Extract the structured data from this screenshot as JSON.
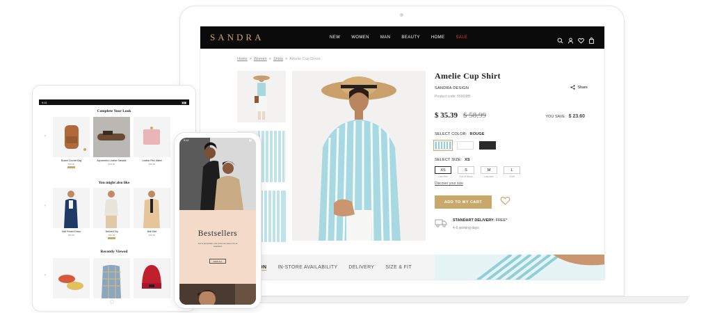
{
  "laptop": {
    "brand": "SANDRA",
    "nav": [
      "NEW",
      "WOMEN",
      "MAN",
      "BEAUTY",
      "HOME",
      "SALE"
    ],
    "nav_icons": [
      "search-icon",
      "user-icon",
      "heart-icon",
      "bag-icon"
    ],
    "breadcrumb": [
      "Home",
      "Women",
      "Shirts",
      "Amelie Cup Dress"
    ],
    "product": {
      "title": "Amelie Cup Shirt",
      "brand": "SANDRA DESIGN",
      "code": "Product code: 5590385",
      "share": "Share",
      "price": "$ 35.39",
      "old_price": "$ 58.99",
      "you_save_label": "YOU SAVE:",
      "you_save_value": "$ 23.60",
      "color_label": "SELECT COLOR:",
      "color_value": "ROUGE",
      "size_label": "SELECT SIZE:",
      "size_value": "XS",
      "size_guide": "Discover your size",
      "sizes": [
        {
          "label": "XS",
          "note": "Last item"
        },
        {
          "label": "S",
          "note": "Out of Stock"
        },
        {
          "label": "M",
          "note": "Last item"
        },
        {
          "label": "L",
          "note": "3 left"
        }
      ],
      "add_to_cart": "ADD TO MY CART",
      "delivery_title": "STANDART DELIVERY:",
      "delivery_free": "FREE*",
      "delivery_time": "4-6 working days"
    },
    "tabs": [
      "ION",
      "IN-STORE AVAILABILITY",
      "DELIVERY",
      "SIZE & FIT"
    ]
  },
  "tablet": {
    "time": "9:41",
    "section1": "Complete Your Look",
    "section2": "You might also like",
    "section3": "Recently Viewed",
    "row1": [
      {
        "name": "Bucket Crochet Bag",
        "price": "$59.99"
      },
      {
        "name": "Asymmetric Leather Sandals",
        "price": "$79.99"
      },
      {
        "name": "Leather Pink Wallet",
        "price": "$49.99"
      }
    ],
    "row2": [
      {
        "name": "Midi Printed Dress",
        "price": "$39.99"
      },
      {
        "name": "Textured Top",
        "price": "$29.99"
      },
      {
        "name": "Belt Shirt",
        "price": "$35.99"
      }
    ]
  },
  "phone": {
    "time": "9:41",
    "title": "Bestsellers",
    "text": "Sed ut perspiciatis unde omnis iste natus error sit voluptatem",
    "button": "VIEW ALL"
  },
  "colors": {
    "accent": "#c9a96b",
    "nav_bg": "#0b0b0b",
    "sale": "#e0322b",
    "stripe": "#8fcfd9",
    "peach": "#f3dac9"
  }
}
